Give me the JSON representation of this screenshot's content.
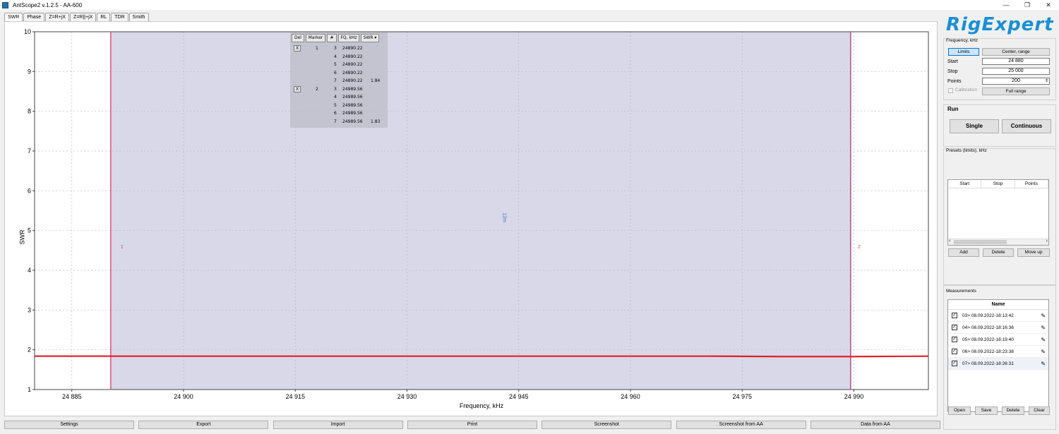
{
  "window": {
    "title": "AntScope2 v.1.2.5 - AA-600",
    "controls": [
      "—",
      "❐",
      "✕"
    ]
  },
  "tabs": [
    "SWR",
    "Phase",
    "Z=R+jX",
    "Z=R||+jX",
    "RL",
    "TDR",
    "Smith"
  ],
  "marker_table": {
    "headers": [
      "Del",
      "Marker",
      "#",
      "FQ, kHz",
      "SWR ▾"
    ],
    "rows": [
      {
        "del": "X",
        "marker": "1",
        "num": "3",
        "fq": "24890.22",
        "swr": ""
      },
      {
        "del": "",
        "marker": "",
        "num": "4",
        "fq": "24890.22",
        "swr": ""
      },
      {
        "del": "",
        "marker": "",
        "num": "5",
        "fq": "24890.22",
        "swr": ""
      },
      {
        "del": "",
        "marker": "",
        "num": "6",
        "fq": "24890.22",
        "swr": ""
      },
      {
        "del": "",
        "marker": "",
        "num": "7",
        "fq": "24890.22",
        "swr": "1.84"
      },
      {
        "del": "X",
        "marker": "2",
        "num": "3",
        "fq": "24989.56",
        "swr": ""
      },
      {
        "del": "",
        "marker": "",
        "num": "4",
        "fq": "24989.56",
        "swr": ""
      },
      {
        "del": "",
        "marker": "",
        "num": "5",
        "fq": "24989.56",
        "swr": ""
      },
      {
        "del": "",
        "marker": "",
        "num": "6",
        "fq": "24989.56",
        "swr": ""
      },
      {
        "del": "",
        "marker": "",
        "num": "7",
        "fq": "24989.56",
        "swr": "1.83"
      }
    ]
  },
  "chart_data": {
    "type": "line",
    "xlabel": "Frequency, kHz",
    "ylabel": "SWR",
    "xlim": [
      24880,
      25000
    ],
    "ylim": [
      1,
      10
    ],
    "x_ticks": [
      24885,
      24900,
      24915,
      24930,
      24945,
      24960,
      24975,
      24990
    ],
    "x_tick_labels": [
      "24 885",
      "24 900",
      "24 915",
      "24 930",
      "24 945",
      "24 960",
      "24 975",
      "24 990"
    ],
    "y_ticks": [
      1,
      2,
      3,
      4,
      5,
      6,
      7,
      8,
      9,
      10
    ],
    "grid": true,
    "band": {
      "x_start": 24890.22,
      "x_end": 24989.56,
      "color": "#d8d8e8",
      "label": "12m"
    },
    "markers": [
      {
        "label": "1",
        "x": 24890.22,
        "color": "#e8506a"
      },
      {
        "label": "2",
        "x": 24989.56,
        "color": "#b05080"
      }
    ],
    "series": [
      {
        "color": "#e0202a",
        "x": [
          24880,
          24890,
          24900,
          24910,
          24920,
          24930,
          24940,
          24950,
          24960,
          24970,
          24980,
          24990,
          25000
        ],
        "values": [
          1.84,
          1.84,
          1.84,
          1.84,
          1.84,
          1.84,
          1.84,
          1.84,
          1.84,
          1.84,
          1.83,
          1.83,
          1.84
        ]
      }
    ]
  },
  "bottom_buttons": [
    "Settings",
    "Export",
    "Import",
    "Print",
    "Screenshot",
    "Screenshot from AA",
    "Data from AA"
  ],
  "right": {
    "logo_text": "RigExpert",
    "frequency": {
      "group_label": "Frequency, kHz",
      "limits_label": "Limits",
      "center_range_label": "Center, range",
      "start_label": "Start",
      "start_value": "24 880",
      "stop_label": "Stop",
      "stop_value": "25 000",
      "points_label": "Points",
      "points_value": "200",
      "calibration_label": "Calibration",
      "full_range_label": "Full range"
    },
    "run": {
      "title": "Run",
      "single_label": "Single",
      "continuous_label": "Continuous"
    },
    "presets": {
      "group_label": "Presets (limits), kHz",
      "columns": [
        "Start",
        "Stop",
        "Points"
      ],
      "add_label": "Add",
      "delete_label": "Delete",
      "move_up_label": "Move up"
    },
    "measurements": {
      "group_label": "Measurements",
      "header": "Name",
      "items": [
        "03> 08.09.2022-18:13:42",
        "04> 08.09.2022-18:16:36",
        "05> 08.09.2022-18:19:40",
        "06> 08.09.2022-18:23:38",
        "07> 08.09.2022-18:26:31"
      ],
      "open_label": "Open",
      "save_label": "Save",
      "delete_label": "Delete",
      "clear_label": "Clear"
    }
  }
}
